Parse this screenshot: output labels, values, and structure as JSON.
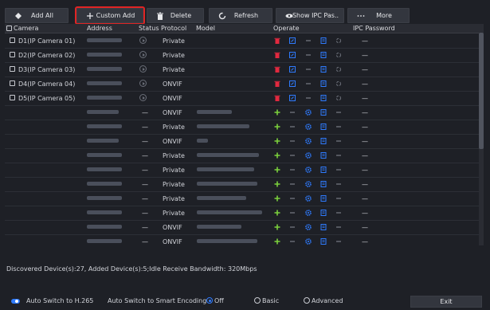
{
  "toolbar": {
    "add_all": "Add All",
    "custom_add": "Custom Add",
    "delete": "Delete",
    "refresh": "Refresh",
    "show_ipc": "Show IPC Pas..",
    "more": "More"
  },
  "table": {
    "headers": [
      "Camera",
      "Address",
      "Status",
      "Protocol",
      "Model",
      "Operate",
      "IPC Password"
    ],
    "added_rows": [
      {
        "camera": "D1(IP Camera 01)",
        "protocol": "Private",
        "password": "—"
      },
      {
        "camera": "D2(IP Camera 02)",
        "protocol": "Private",
        "password": "—"
      },
      {
        "camera": "D3(IP Camera 03)",
        "protocol": "Private",
        "password": "—"
      },
      {
        "camera": "D4(IP Camera 04)",
        "protocol": "ONVIF",
        "password": "—"
      },
      {
        "camera": "D5(IP Camera 05)",
        "protocol": "ONVIF",
        "password": "—"
      }
    ],
    "discovered_rows": [
      {
        "status": "—",
        "protocol": "ONVIF",
        "password": "—"
      },
      {
        "status": "—",
        "protocol": "Private",
        "password": "—"
      },
      {
        "status": "—",
        "protocol": "ONVIF",
        "password": "—"
      },
      {
        "status": "—",
        "protocol": "Private",
        "password": "—"
      },
      {
        "status": "—",
        "protocol": "Private",
        "password": "—"
      },
      {
        "status": "—",
        "protocol": "Private",
        "password": "—"
      },
      {
        "status": "—",
        "protocol": "Private",
        "password": "—"
      },
      {
        "status": "—",
        "protocol": "Private",
        "password": "—"
      },
      {
        "status": "—",
        "protocol": "ONVIF",
        "password": "—"
      },
      {
        "status": "—",
        "protocol": "ONVIF",
        "password": "—"
      }
    ]
  },
  "status_text": "Discovered Device(s):27, Added Device(s):5;Idle Receive Bandwidth: 320Mbps",
  "footer": {
    "auto_h265": "Auto Switch to H.265",
    "smart_encoding": "Auto Switch to Smart Encoding",
    "off": "Off",
    "basic": "Basic",
    "advanced": "Advanced",
    "exit": "Exit"
  },
  "colors": {
    "accent": "#2f7bff",
    "delete_red": "#e2293f",
    "edit_blue": "#2f7bff",
    "add_green": "#7bd13c",
    "highlight_red": "#e02424"
  }
}
